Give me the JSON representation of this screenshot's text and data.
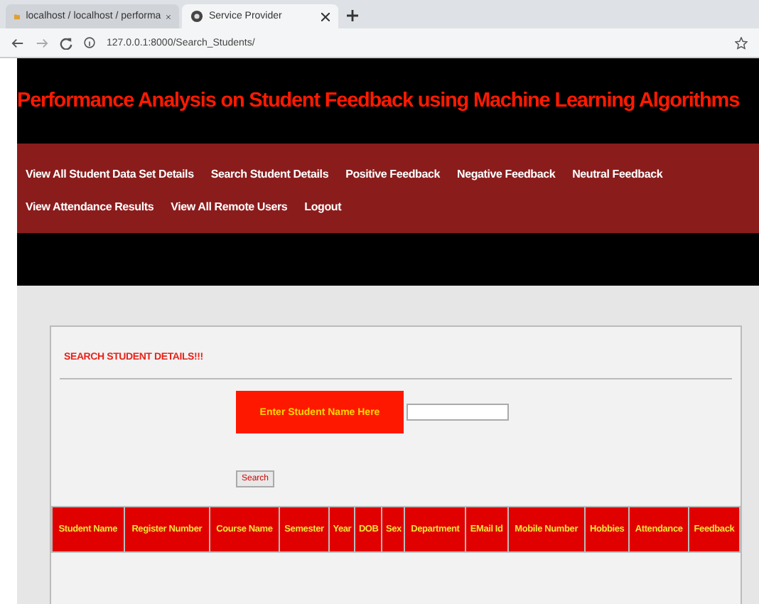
{
  "browser": {
    "tabs": [
      {
        "title": "localhost / localhost / performa",
        "selected": false
      },
      {
        "title": "Service Provider",
        "selected": true
      }
    ],
    "address": "127.0.0.1:8000/Search_Students/"
  },
  "header": {
    "title": "Performance Analysis on Student Feedback using Machine Learning Algorithms"
  },
  "nav": {
    "links": [
      "View All Student Data Set Details",
      "Search Student Details",
      "Positive Feedback",
      "Negative Feedback",
      "Neutral Feedback",
      "View Attendance Results",
      "View All Remote Users",
      "Logout"
    ]
  },
  "search_panel": {
    "heading": "SEARCH STUDENT DETAILS!!!",
    "field_label": "Enter Student Name Here",
    "button": "Search"
  },
  "table": {
    "columns": [
      "Student Name",
      "Register Number",
      "Course Name",
      "Semester",
      "Year",
      "DOB",
      "Sex",
      "Department",
      "EMail Id",
      "Mobile Number",
      "Hobbies",
      "Attendance",
      "Feedback"
    ]
  }
}
